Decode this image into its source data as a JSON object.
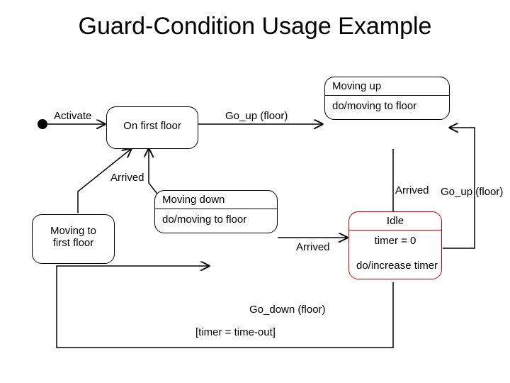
{
  "title": "Guard-Condition Usage Example",
  "states": {
    "on_first_floor": {
      "name": "On first floor"
    },
    "moving_up": {
      "name": "Moving up",
      "activity": "do/moving to floor"
    },
    "moving_down": {
      "name": "Moving down",
      "activity": "do/moving to floor"
    },
    "moving_to_first_floor": {
      "name": "Moving to\nfirst floor"
    },
    "idle": {
      "name": "Idle",
      "activity": "do/increase timer",
      "entry": "timer = 0"
    }
  },
  "transitions": {
    "activate": "Activate",
    "go_up": "Go_up (floor)",
    "go_up2": "Go_up (floor)",
    "arrived1": "Arrived",
    "arrived2": "Arrived",
    "arrived3": "Arrived",
    "go_down": "Go_down (floor)",
    "guard": "[timer = time-out]"
  },
  "chart_data": {
    "type": "state_machine",
    "title": "Guard-Condition Usage Example",
    "initial": "On first floor",
    "states": [
      {
        "id": "on_first_floor",
        "label": "On first floor"
      },
      {
        "id": "moving_up",
        "label": "Moving up",
        "do": "moving to floor"
      },
      {
        "id": "moving_down",
        "label": "Moving down",
        "do": "moving to floor"
      },
      {
        "id": "moving_to_first_floor",
        "label": "Moving to first floor"
      },
      {
        "id": "idle",
        "label": "Idle",
        "entry": "timer = 0",
        "do": "increase timer"
      }
    ],
    "transitions": [
      {
        "from": "INITIAL",
        "to": "on_first_floor",
        "event": "Activate"
      },
      {
        "from": "on_first_floor",
        "to": "moving_up",
        "event": "Go_up (floor)"
      },
      {
        "from": "moving_up",
        "to": "idle",
        "event": "Arrived"
      },
      {
        "from": "idle",
        "to": "moving_up",
        "event": "Go_up (floor)"
      },
      {
        "from": "idle",
        "to": "moving_down",
        "event": "Go_down (floor)",
        "guard": "timer = time-out"
      },
      {
        "from": "moving_down",
        "to": "idle",
        "event": "Arrived"
      },
      {
        "from": "moving_down",
        "to": "on_first_floor",
        "event": "Arrived"
      },
      {
        "from": "moving_to_first_floor",
        "to": "on_first_floor",
        "event": ""
      }
    ]
  }
}
